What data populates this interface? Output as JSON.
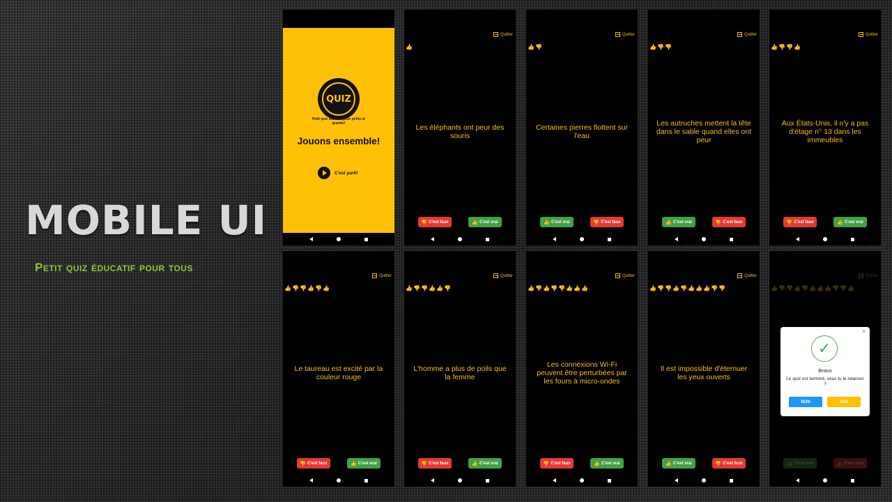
{
  "promo": {
    "title": "MOBILE UI",
    "subtitle": "Petit quiz éducatif pour tous"
  },
  "colors": {
    "accent": "#f5c01b",
    "background": "#000000",
    "true_button": "#43a047",
    "false_button": "#e53935",
    "thumb_up": "#66e23a",
    "thumb_down": "#ff3030"
  },
  "home": {
    "logo_text": "QUIZ",
    "tagline": "Petit quiz éducatif pour petits et grands!",
    "title": "Jouons ensemble!",
    "start_label": "C'est parti!"
  },
  "quit_label": "Quitter",
  "false_label": "C'est faux",
  "true_label": "C'est vrai",
  "questions": [
    "Les éléphants ont peur des souris",
    "Certaines pierres flottent sur l'eau",
    "Les autruches mettent la tête dans le sable quand elles ont peur",
    "Aux États-Unis, il n'y a pas d'étage n° 13 dans les immeubles",
    "Le taureau est excité par la couleur rouge",
    "L'homme a plus de poils que la femme",
    "Les connexions Wi-Fi peuvent être perturbées par les fours à micro-ondes",
    "Il est impossible d'éternuer les yeux ouverts"
  ],
  "scores": [
    [
      "up"
    ],
    [
      "up",
      "down"
    ],
    [
      "up",
      "down",
      "down"
    ],
    [
      "up",
      "down",
      "down",
      "up"
    ],
    [
      "up",
      "down",
      "down",
      "up",
      "down",
      "up"
    ],
    [
      "up",
      "down",
      "down",
      "up",
      "up",
      "down"
    ],
    [
      "up",
      "down",
      "up",
      "down",
      "down",
      "up",
      "up",
      "up"
    ],
    [
      "up",
      "down",
      "down",
      "up",
      "down",
      "up",
      "up",
      "up",
      "down",
      "down"
    ],
    [
      "up",
      "down",
      "down",
      "up",
      "down",
      "up",
      "up",
      "up",
      "down",
      "down",
      "up"
    ]
  ],
  "dialog": {
    "title": "Bravo",
    "message": "Le quiz est terminé, veux tu le relancer ?",
    "no_label": "NON",
    "yes_label": "OUI"
  }
}
